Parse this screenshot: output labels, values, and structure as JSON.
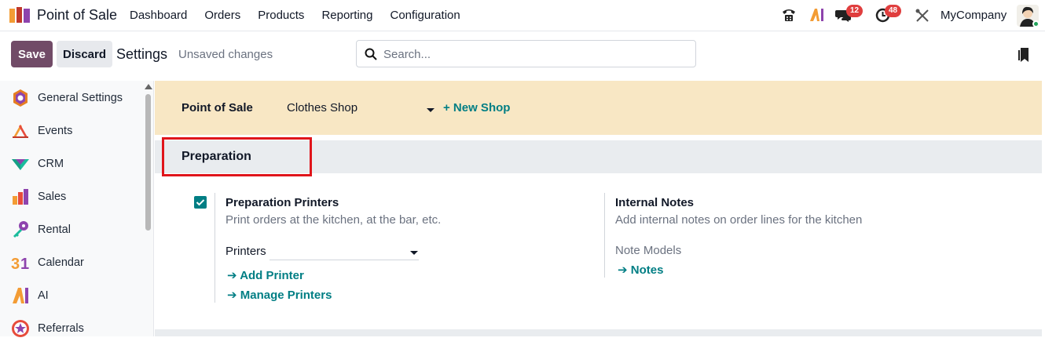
{
  "navbar": {
    "app_name": "Point of Sale",
    "menu": [
      "Dashboard",
      "Orders",
      "Products",
      "Reporting",
      "Configuration"
    ],
    "messages_badge": "12",
    "activities_badge": "48",
    "company": "MyCompany"
  },
  "control": {
    "save_label": "Save",
    "discard_label": "Discard",
    "title": "Settings",
    "status": "Unsaved changes",
    "search_placeholder": "Search..."
  },
  "sidebar": {
    "items": [
      {
        "label": "General Settings",
        "icon": "general-settings-icon"
      },
      {
        "label": "Events",
        "icon": "events-icon"
      },
      {
        "label": "CRM",
        "icon": "crm-icon"
      },
      {
        "label": "Sales",
        "icon": "sales-icon"
      },
      {
        "label": "Rental",
        "icon": "rental-icon"
      },
      {
        "label": "Calendar",
        "icon": "calendar-icon"
      },
      {
        "label": "AI",
        "icon": "ai-icon"
      },
      {
        "label": "Referrals",
        "icon": "referrals-icon"
      }
    ]
  },
  "shop": {
    "label": "Point of Sale",
    "selected": "Clothes Shop",
    "new_shop": "+ New Shop"
  },
  "section": {
    "title": "Preparation"
  },
  "settings": {
    "printers": {
      "title": "Preparation Printers",
      "description": "Print orders at the kitchen, at the bar, etc.",
      "checked": true,
      "field_label": "Printers",
      "add_link": "Add Printer",
      "manage_link": "Manage Printers"
    },
    "notes": {
      "title": "Internal Notes",
      "description": "Add internal notes on order lines for the kitchen",
      "field_label": "Note Models",
      "link": "Notes"
    }
  },
  "colors": {
    "primary": "#714b67",
    "accent": "#017e84",
    "shop_bar": "#f8e7c4",
    "highlight": "#e0151b"
  }
}
